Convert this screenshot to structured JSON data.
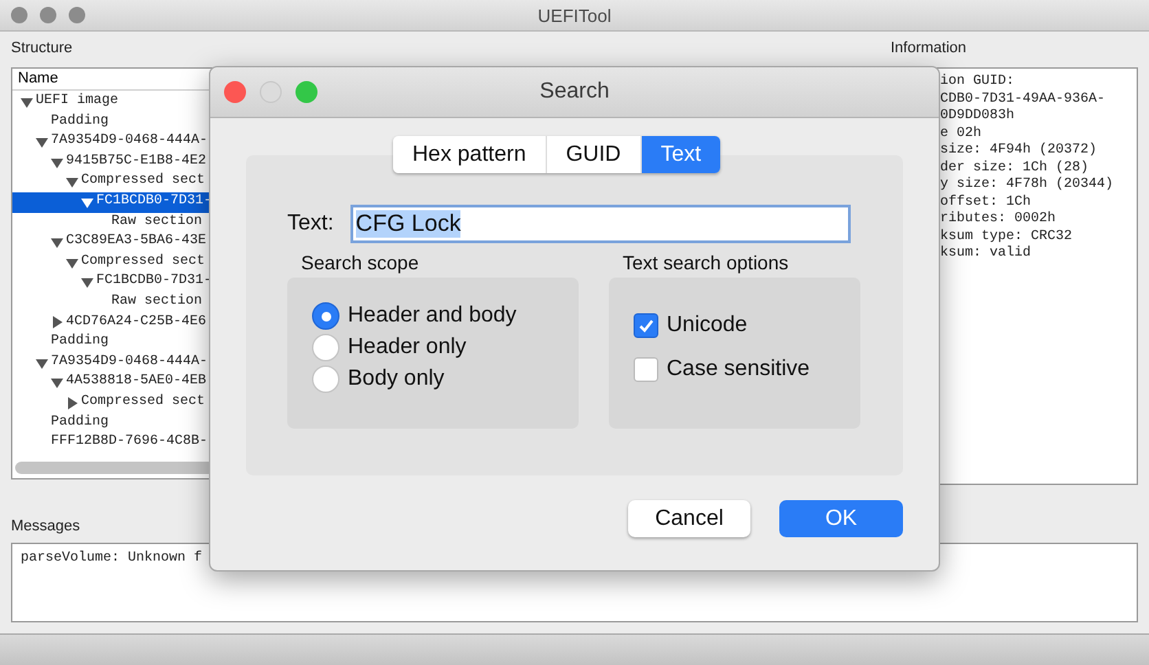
{
  "window": {
    "title": "UEFITool"
  },
  "structure": {
    "label": "Structure",
    "column": "Name",
    "tree": [
      {
        "name": "UEFI image",
        "expanded": true,
        "selected": false,
        "children": [
          {
            "name": "Padding",
            "selected": false
          },
          {
            "name": "7A9354D9-0468-444A-",
            "expanded": true,
            "selected": false,
            "children": [
              {
                "name": "9415B75C-E1B8-4E2",
                "expanded": true,
                "selected": false,
                "children": [
                  {
                    "name": "Compressed sect",
                    "expanded": true,
                    "selected": false,
                    "children": [
                      {
                        "name": "FC1BCDB0-7D31-",
                        "expanded": true,
                        "selected": true,
                        "children": [
                          {
                            "name": "Raw section",
                            "selected": false
                          }
                        ]
                      }
                    ]
                  }
                ]
              },
              {
                "name": "C3C89EA3-5BA6-43E",
                "expanded": true,
                "selected": false,
                "children": [
                  {
                    "name": "Compressed sect",
                    "expanded": true,
                    "selected": false,
                    "children": [
                      {
                        "name": "FC1BCDB0-7D31-",
                        "expanded": true,
                        "selected": false,
                        "children": [
                          {
                            "name": "Raw section",
                            "selected": false
                          }
                        ]
                      }
                    ]
                  }
                ]
              },
              {
                "name": "4CD76A24-C25B-4E6",
                "expanded": false,
                "selected": false
              }
            ]
          },
          {
            "name": "Padding",
            "selected": false
          },
          {
            "name": "7A9354D9-0468-444A-",
            "expanded": true,
            "selected": false,
            "children": [
              {
                "name": "4A538818-5AE0-4EB",
                "expanded": true,
                "selected": false,
                "children": [
                  {
                    "name": "Compressed sect",
                    "expanded": false,
                    "selected": false
                  }
                ]
              }
            ]
          },
          {
            "name": "Padding",
            "selected": false
          },
          {
            "name": "FFF12B8D-7696-4C8B-",
            "selected": false
          }
        ]
      }
    ]
  },
  "information": {
    "label": "Information",
    "lines": [
      "ion GUID:",
      "CDB0-7D31-49AA-936A-",
      "0D9DD083h",
      "e 02h",
      "size: 4F94h (20372)",
      "der size: 1Ch (28)",
      "y size: 4F78h (20344)",
      "offset: 1Ch",
      "ributes: 0002h",
      "ksum type: CRC32",
      "ksum: valid"
    ]
  },
  "messages": {
    "label": "Messages",
    "lines": [
      "parseVolume: Unknown f"
    ]
  },
  "dialog": {
    "title": "Search",
    "tabs": [
      {
        "label": "Hex pattern",
        "selected": false
      },
      {
        "label": "GUID",
        "selected": false
      },
      {
        "label": "Text",
        "selected": true
      }
    ],
    "text_field": {
      "label": "Text:",
      "value": "CFG Lock",
      "selected": true
    },
    "scope": {
      "label": "Search scope",
      "options": [
        {
          "label": "Header and body",
          "selected": true
        },
        {
          "label": "Header only",
          "selected": false
        },
        {
          "label": "Body only",
          "selected": false
        }
      ]
    },
    "options": {
      "label": "Text search options",
      "checks": [
        {
          "label": "Unicode",
          "checked": true
        },
        {
          "label": "Case sensitive",
          "checked": false
        }
      ]
    },
    "buttons": [
      {
        "label": "Cancel",
        "kind": "secondary"
      },
      {
        "label": "OK",
        "kind": "primary"
      }
    ]
  }
}
